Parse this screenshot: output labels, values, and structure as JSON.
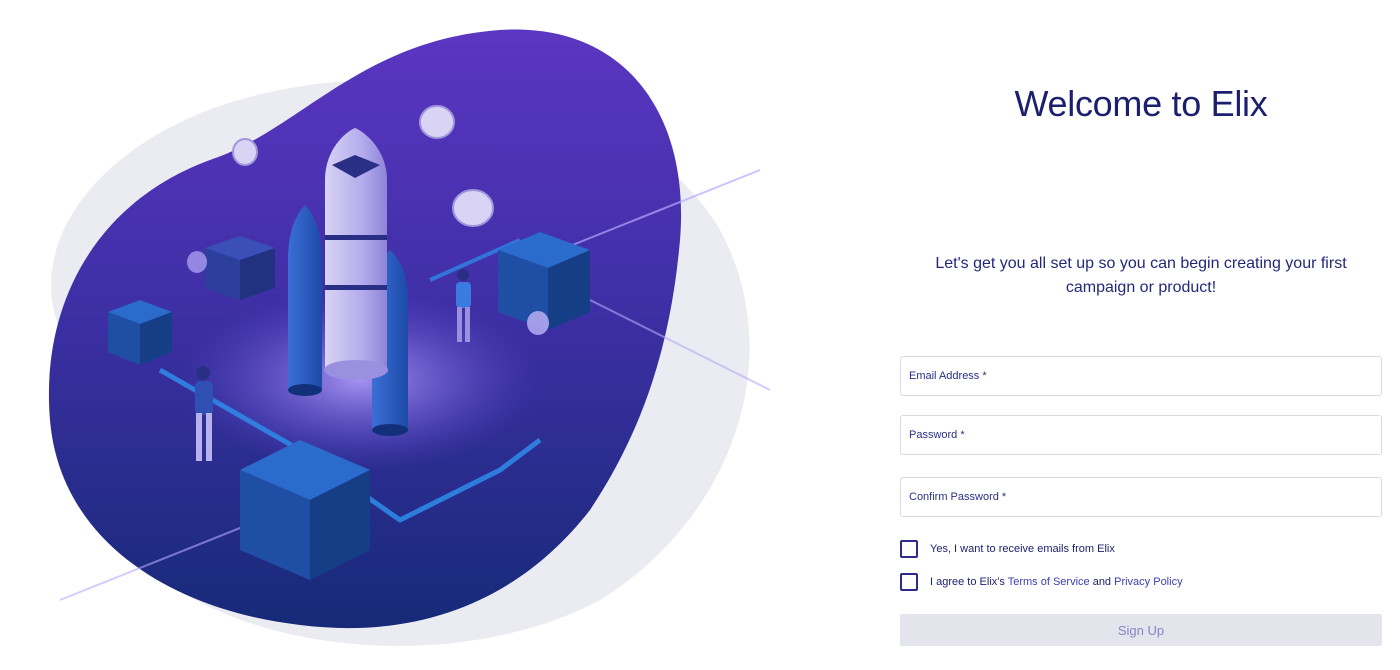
{
  "colors": {
    "blob_top": "#5a35c0",
    "blob_bottom": "#1b2a7a",
    "accent": "#3a3fb0",
    "title": "#1c1f6e",
    "button_bg": "#e4e4ec",
    "button_text": "#8a84c8"
  },
  "illustration": {
    "icon": "rocket-launch-illustration"
  },
  "header": {
    "title": "Welcome to Elix"
  },
  "intro": {
    "text": "Let's get you all set up so you can begin creating your first campaign or product!"
  },
  "form": {
    "email_placeholder": "Email Address *",
    "password_placeholder": "Password *",
    "confirm_placeholder": "Confirm Password *",
    "checkbox_emails": {
      "label": "Yes, I want to receive emails from Elix",
      "checked": false
    },
    "checkbox_terms": {
      "prefix": "I agree to Elix's ",
      "terms_link": "Terms of Service",
      "conjunction": " and ",
      "privacy_link": "Privacy Policy",
      "checked": false
    },
    "submit_label": "Sign Up"
  }
}
